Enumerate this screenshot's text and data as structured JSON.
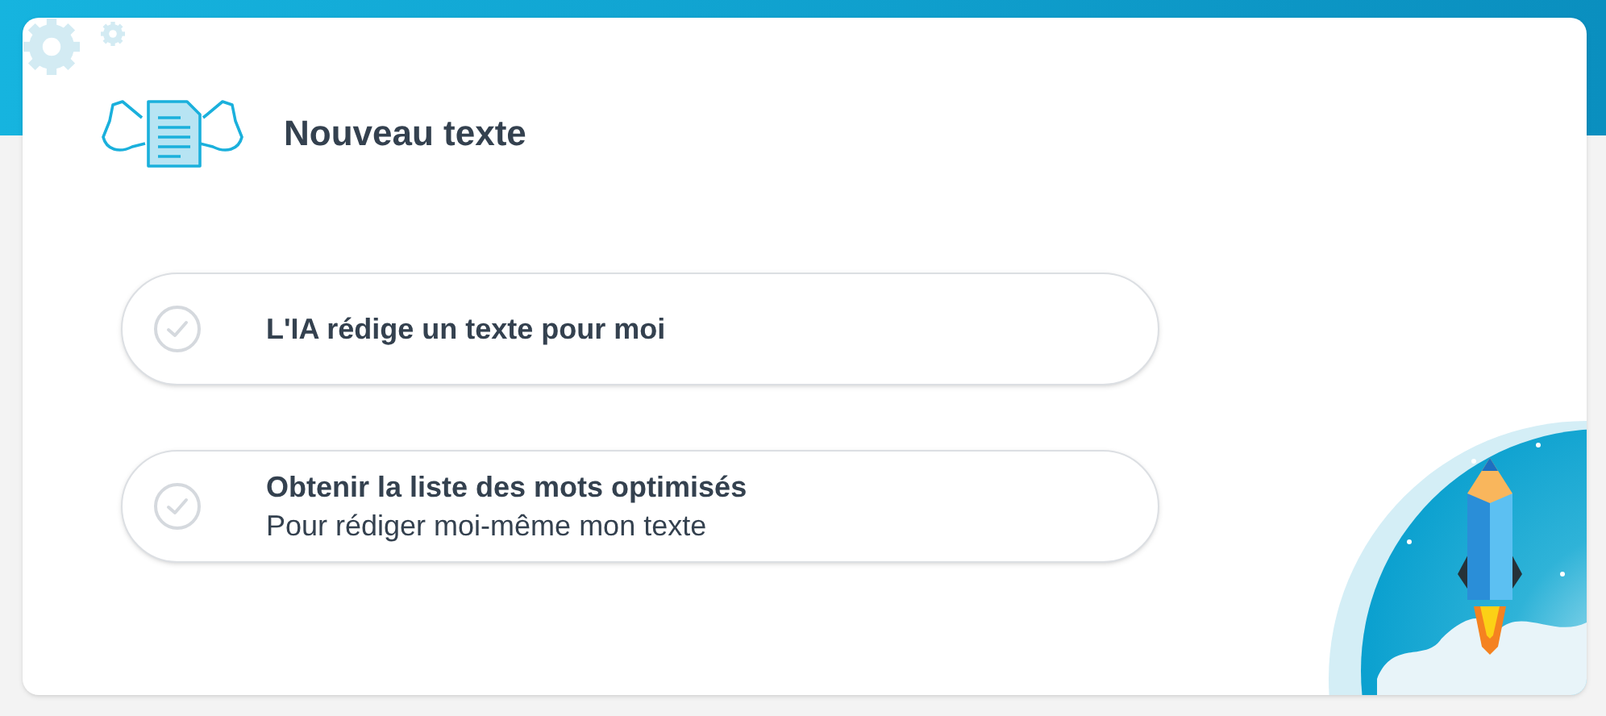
{
  "title": "Nouveau texte",
  "options": [
    {
      "label": "L'IA rédige un texte pour moi",
      "selected": false
    },
    {
      "label": "Obtenir la liste des mots optimisés",
      "subtitle": "Pour rédiger moi-même mon texte",
      "selected": false
    }
  ]
}
